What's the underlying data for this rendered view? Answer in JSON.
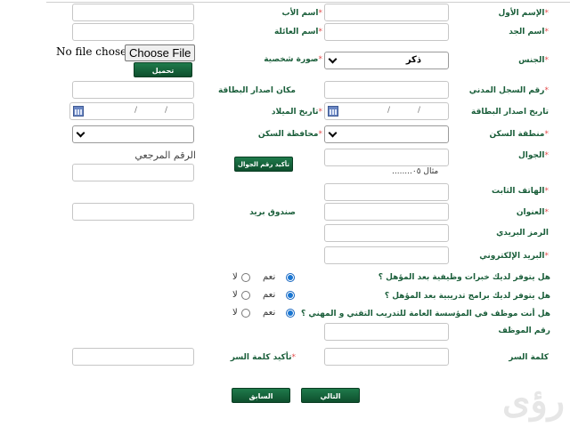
{
  "labels": {
    "first_name": "الإسم الأول",
    "father_name": "اسم الأب",
    "grandfather_name": "اسم الجد",
    "family_name": "اسم العائلة",
    "gender": "الجنس",
    "photo": "صورة شخصية",
    "civil_id": "رقم السجل المدني",
    "card_issue_place": "مكان اصدار البطاقة",
    "card_issue_date": "تاريخ اصدار البطاقة",
    "birth_date": "تاريخ الميلاد",
    "residence_region": "منطقة السكن",
    "residence_governorate": "محافظة السكن",
    "mobile": "الجوال",
    "reference_number": "الرقم المرجعي",
    "landline": "الهاتف الثابت",
    "address": "العنوان",
    "po_box": "صندوق بريد",
    "postal_code": "الرمز البريدي",
    "email": "البريد الإلكتروني",
    "employee_number": "رقم الموظف",
    "password": "كلمة السر",
    "confirm_password": "تأكيد كلمة السر"
  },
  "required_mark": "*",
  "file": {
    "no_file": "No file chosen",
    "choose": "Choose File"
  },
  "buttons": {
    "upload": "تحميل",
    "confirm_mobile": "تأكيد رقم الجوال",
    "next": "التالي",
    "previous": "السابق"
  },
  "gender_select": {
    "value": "ذكر"
  },
  "mobile_hint": "مثال ٠٥........",
  "date_placeholder": {
    "sep": "/"
  },
  "questions": [
    {
      "text": "هل يتوفر لديك خبرات وظيفية بعد المؤهل ؟",
      "yes": "نعم",
      "no": "لا",
      "selected": "yes"
    },
    {
      "text": "هل يتوفر لديك برامج تدريبية بعد المؤهل ؟",
      "yes": "نعم",
      "no": "لا",
      "selected": "yes"
    },
    {
      "text": "هل أنت موظف في المؤسسة العامة للتدريب التقني و المهني ؟",
      "yes": "نعم",
      "no": "لا",
      "selected": "yes"
    }
  ],
  "colors": {
    "label_green": "#1a5e3a",
    "button_green": "#0e5a33",
    "required_red": "#e34a4a"
  },
  "watermark": "رؤى"
}
